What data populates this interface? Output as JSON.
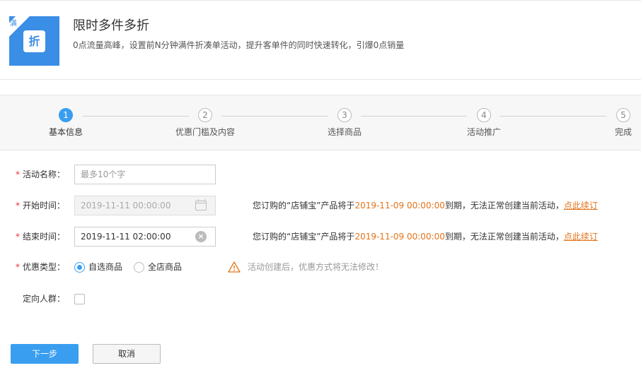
{
  "header": {
    "title": "限时多件多折",
    "subtitle": "0点流量高峰，设置前N分钟满件折凑单活动，提升客单件的同时快速转化，引爆0点销量",
    "logo_badge": "折",
    "logo_corner": "满"
  },
  "steps": [
    {
      "num": "1",
      "label": "基本信息",
      "active": true
    },
    {
      "num": "2",
      "label": "优惠门槛及内容",
      "active": false
    },
    {
      "num": "3",
      "label": "选择商品",
      "active": false
    },
    {
      "num": "4",
      "label": "活动推广",
      "active": false
    },
    {
      "num": "5",
      "label": "完成",
      "active": false
    }
  ],
  "form": {
    "required_mark": "*",
    "name": {
      "label": "活动名称：",
      "placeholder": "最多10个字"
    },
    "start": {
      "label": "开始时间：",
      "value": "2019-11-11 00:00:00"
    },
    "end": {
      "label": "结束时间：",
      "value": "2019-11-11 02:00:00"
    },
    "notice": {
      "prefix": "您订购的“店铺宝”产品将于",
      "date": "2019-11-09 00:00:00",
      "suffix": "到期，无法正常创建当前活动，",
      "link": "点此续订"
    },
    "discount_type": {
      "label": "优惠类型：",
      "options": [
        "自选商品",
        "全店商品"
      ],
      "selected": "自选商品",
      "warning": "活动创建后，优惠方式将无法修改！"
    },
    "audience": {
      "label": "定向人群：",
      "checked": false
    }
  },
  "actions": {
    "next": "下一步",
    "cancel": "取消"
  },
  "colors": {
    "accent": "#3a9ef0",
    "warning": "#e37318",
    "required": "#e33333"
  }
}
